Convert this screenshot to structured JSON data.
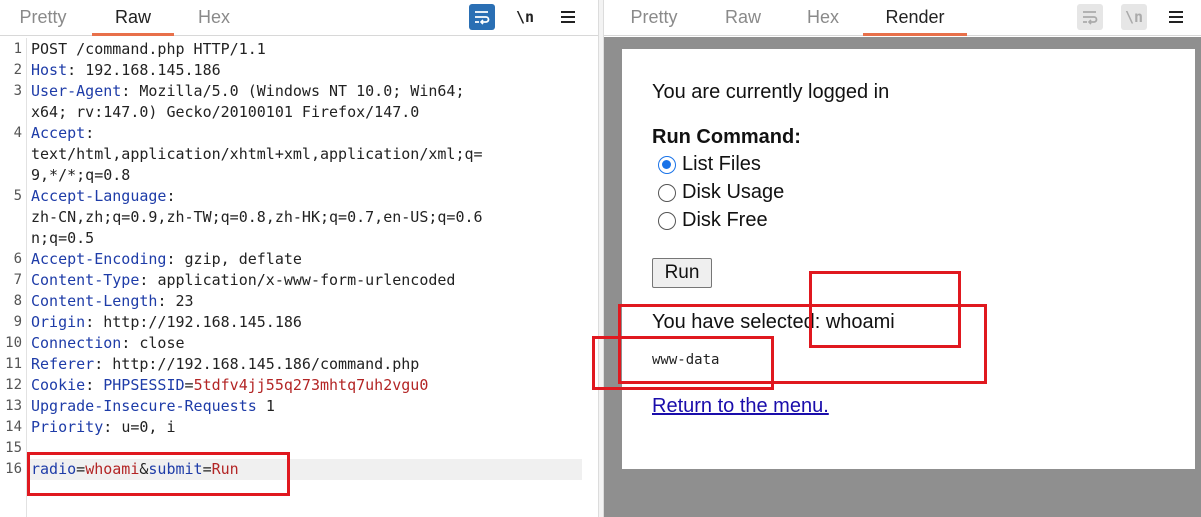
{
  "request_pane": {
    "tabs": [
      {
        "label": "Pretty",
        "active": false
      },
      {
        "label": "Raw",
        "active": true
      },
      {
        "label": "Hex",
        "active": false
      }
    ],
    "toolbar": {
      "wrap_icon": "word-wrap-icon",
      "newline_label": "\\n",
      "menu_icon": "hamburger-menu-icon"
    },
    "line_numbers": [
      "1",
      "2",
      "3",
      "4",
      "5",
      "6",
      "7",
      "8",
      "9",
      "10",
      "11",
      "12",
      "13",
      "14",
      "15",
      "16"
    ],
    "request_line": "POST /command.php HTTP/1.1",
    "headers": [
      {
        "name": "Host",
        "sep": ": ",
        "value": "192.168.145.186"
      },
      {
        "name": "User-Agent",
        "sep": ": ",
        "value": "Mozilla/5.0 (Windows NT 10.0; Win64;",
        "value_cont": "x64; rv:147.0) Gecko/20100101 Firefox/147.0"
      },
      {
        "name": "Accept",
        "sep": ":",
        "value": "text/html,application/xhtml+xml,application/xml;q=",
        "value_cont": "9,*/*;q=0.8"
      },
      {
        "name": "Accept-Language",
        "sep": ":",
        "value": "zh-CN,zh;q=0.9,zh-TW;q=0.8,zh-HK;q=0.7,en-US;q=0.6",
        "value_cont": "n;q=0.5"
      },
      {
        "name": "Accept-Encoding",
        "sep": ": ",
        "value": "gzip, deflate"
      },
      {
        "name": "Content-Type",
        "sep": ": ",
        "value": "application/x-www-form-urlencoded"
      },
      {
        "name": "Content-Length",
        "sep": ": ",
        "value": "23"
      },
      {
        "name": "Origin",
        "sep": ": ",
        "value": "http://192.168.145.186"
      },
      {
        "name": "Connection",
        "sep": ": ",
        "value": "close"
      },
      {
        "name": "Referer",
        "sep": ": ",
        "value": "http://192.168.145.186/command.php"
      },
      {
        "name": "Cookie",
        "sep": ": ",
        "cookie_name": "PHPSESSID",
        "cookie_eq": "=",
        "cookie_value": "5tdfv4jj55q273mhtq7uh2vgu0"
      },
      {
        "name": "Upgrade-Insecure-Requests",
        "sep": " ",
        "value": "1"
      },
      {
        "name": "Priority",
        "sep": ": ",
        "value": "u=0, i"
      }
    ],
    "body": {
      "k1": "radio",
      "eq": "=",
      "v1": "whoami",
      "amp": "&",
      "k2": "submit",
      "v2": "Run"
    }
  },
  "response_pane": {
    "tabs": [
      {
        "label": "Pretty",
        "active": false
      },
      {
        "label": "Raw",
        "active": false
      },
      {
        "label": "Hex",
        "active": false
      },
      {
        "label": "Render",
        "active": true
      }
    ],
    "toolbar": {
      "wrap_icon": "word-wrap-icon",
      "newline_label": "\\n",
      "menu_icon": "hamburger-menu-icon"
    },
    "render": {
      "logged_in_text": "You are currently logged in",
      "run_command_label": "Run Command:",
      "options": [
        {
          "label": "List Files",
          "checked": true
        },
        {
          "label": "Disk Usage",
          "checked": false
        },
        {
          "label": "Disk Free",
          "checked": false
        }
      ],
      "run_button": "Run",
      "selected_text": "You have selected: whoami",
      "command_output": "www-data",
      "return_link": "Return to the menu."
    }
  },
  "colors": {
    "header_name": "#1e3ca8",
    "param_value": "#b32525",
    "active_tab_underline": "#e8704a",
    "highlight_box": "#e0181f",
    "link": "#1a0dab"
  }
}
